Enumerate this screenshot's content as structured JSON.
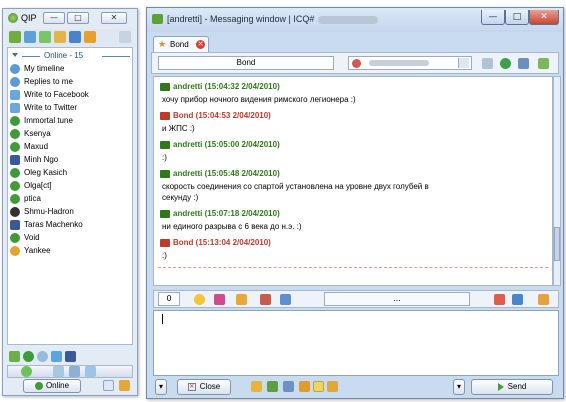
{
  "contact_list": {
    "title": "QIP",
    "group_header": "Online - 15",
    "contacts": [
      {
        "name": "My timeline",
        "icon": "contact-icon"
      },
      {
        "name": "Replies to me",
        "icon": "contact-icon"
      },
      {
        "name": "Write to Facebook",
        "icon": "note-icon"
      },
      {
        "name": "Write to Twitter",
        "icon": "note-icon"
      },
      {
        "name": "Immortal tune",
        "icon": "flower-icon"
      },
      {
        "name": "Ksenya",
        "icon": "flower-icon"
      },
      {
        "name": "Maxud",
        "icon": "flower-icon"
      },
      {
        "name": "Minh Ngo",
        "icon": "facebook-icon"
      },
      {
        "name": "Oleg Kasich",
        "icon": "flower-icon"
      },
      {
        "name": "Olga[ct]",
        "icon": "flower-icon"
      },
      {
        "name": "ptica",
        "icon": "flower-icon"
      },
      {
        "name": "Shmu-Hadron",
        "icon": "glasses-icon"
      },
      {
        "name": "Taras Machenko",
        "icon": "facebook-icon"
      },
      {
        "name": "Void",
        "icon": "flower-icon"
      },
      {
        "name": "Yankee",
        "icon": "star-icon"
      }
    ],
    "status_label": "Online"
  },
  "message_window": {
    "title": "[andretti] - Messaging window | ICQ#",
    "tab_label": "Bond",
    "nick_field": "Bond",
    "messages": [
      {
        "sender": "andretti",
        "timestamp": "(15:04:32 2/04/2010)",
        "color": "#2e7a18",
        "lines": [
          "хочу прибор ночного видения римского легионера :)"
        ]
      },
      {
        "sender": "Bond",
        "timestamp": "(15:04:53 2/04/2010)",
        "color": "#c0392b",
        "lines": [
          "и ЖПС :)"
        ]
      },
      {
        "sender": "andretti",
        "timestamp": "(15:05:00 2/04/2010)",
        "color": "#2e7a18",
        "lines": [
          ":)"
        ]
      },
      {
        "sender": "andretti",
        "timestamp": "(15:05:48 2/04/2010)",
        "color": "#2e7a18",
        "lines": [
          "скорость соединения со спартой установлена на уровне двух голубей в",
          "секунду :)"
        ]
      },
      {
        "sender": "andretti",
        "timestamp": "(15:07:18 2/04/2010)",
        "color": "#2e7a18",
        "lines": [
          "ни единого разрыва с 6 века до н.э. :)"
        ]
      },
      {
        "sender": "Bond",
        "timestamp": "(15:13:04 2/04/2010)",
        "color": "#c0392b",
        "lines": [
          ":)"
        ]
      }
    ],
    "char_count": "0",
    "ellipsis_label": "...",
    "close_button": "Close",
    "send_button": "Send"
  },
  "colors": {
    "window_frame": "#c9dbef",
    "accent_green": "#2e7a18",
    "accent_red": "#c0392b"
  }
}
